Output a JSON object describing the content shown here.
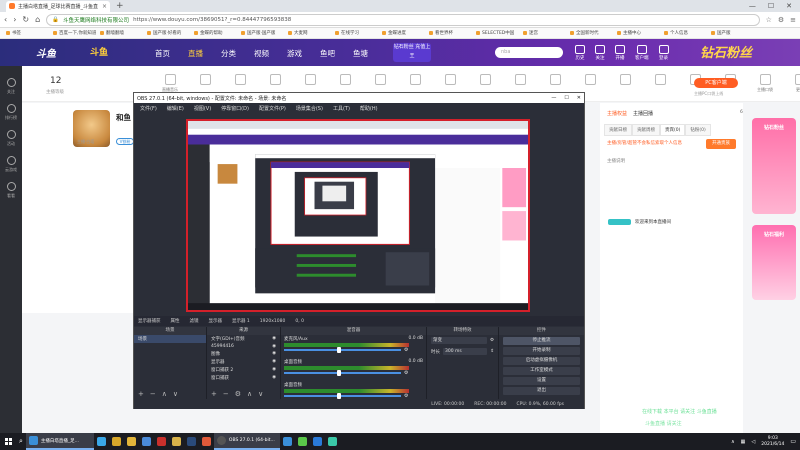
{
  "browser": {
    "tab_title": "主播白塔直播_足球比赛直播_斗鱼直",
    "new_tab": "+",
    "host": "斗鱼天鹰网络科技有限公司",
    "url": "https://www.douyu.com/3869051?_r=0.84447796593838",
    "bookmarks": [
      "书签",
      "百度一下,你就知道",
      "翻墙翻墙",
      "国产版·好看的",
      "金蝶的帮助",
      "国产版·国产版",
      "大麦网",
      "在线学习",
      "金蝶进度",
      "看世界杯",
      "SELECTED中国",
      "迷宫",
      "全国新时代",
      "主播中心",
      "个人信息",
      "国产版"
    ]
  },
  "site": {
    "logo": "斗鱼",
    "logo_sub": "斗鱼",
    "nav": [
      "首页",
      "直播",
      "分类",
      "视频",
      "游戏",
      "鱼吧",
      "鱼塘"
    ],
    "nav_active": 1,
    "promo": "钻石粉丝 充值上王",
    "search_placeholder": "nba",
    "header_icons": [
      "历史",
      "关注",
      "开播",
      "客户端",
      "登录"
    ],
    "banner_text": "钻石粉丝"
  },
  "leftbar": {
    "items": [
      "关注",
      "排行榜",
      "活动",
      "云游戏",
      "看看"
    ]
  },
  "room": {
    "fans": "12",
    "fans_label": "主播等级",
    "tools": [
      "直播音乐",
      "",
      "",
      "",
      "",
      "",
      "",
      "",
      "",
      "",
      "",
      "",
      "",
      "",
      "",
      "",
      "",
      "主播口袋",
      "更多"
    ],
    "pc_btn": "PC客户端",
    "pc_sub": "主播PC口袋上线",
    "streamer_name": "和鱼",
    "streamer_tag": "V铁粉",
    "streamer_tag2": "主播·白塔"
  },
  "chat": {
    "top_tabs": [
      "主播权益",
      "主播回播"
    ],
    "badge": "6",
    "tabs": [
      "贡献日榜",
      "贡献周榜",
      "贵宾(0)",
      "钻粉(0)"
    ],
    "notice": "主播/房管/超管不会私信索取个人信息",
    "action_btn": "开通贵族",
    "msg1": "主播说明",
    "msg2": "欢迎来到本直播间"
  },
  "ads": [
    "钻石粉丝",
    "钻石福利"
  ],
  "obs": {
    "title": "OBS 27.0.1 (64-bit, windows) - 配置文件: 未命名 - 场景: 未命名",
    "menu": [
      "文件(F)",
      "编辑(E)",
      "视图(V)",
      "停靠窗口(D)",
      "配置文件(P)",
      "场景集合(S)",
      "工具(T)",
      "帮助(H)"
    ],
    "status_strip": [
      "显示器捕获",
      "属性",
      "滤镜",
      "显示器",
      "显示器 1",
      "1920x1080",
      "0, 0"
    ],
    "docks": {
      "scenes": {
        "title": "场景",
        "items": [
          "场景"
        ]
      },
      "sources": {
        "title": "来源",
        "items": [
          "文字(GDI+)音频",
          "45994416",
          "图像",
          "显示器",
          "窗口捕获 2",
          "窗口捕获"
        ]
      },
      "mixer": {
        "title": "混音器",
        "tracks": [
          {
            "name": "麦克风/Aux",
            "db": "0.0 dB"
          },
          {
            "name": "桌面音频",
            "db": "0.0 dB"
          },
          {
            "name": "桌面音频",
            "db": ""
          }
        ]
      },
      "transitions": {
        "title": "转场特效",
        "type_label": "渐变",
        "duration_label": "时长",
        "duration": "300 ms"
      },
      "controls": {
        "title": "控件",
        "buttons": [
          "停止推流",
          "开始录制",
          "启动虚拟摄像机",
          "工作室模式",
          "设置",
          "退出"
        ]
      }
    },
    "status": {
      "live": "LIVE: 00:00:00",
      "rec": "REC: 00:00:00",
      "cpu": "CPU: 0.9%, 60.00 fps"
    }
  },
  "watermark": [
    "在线下载 本平台 请关注 斗鱼直播",
    "斗鱼直播 请关注"
  ],
  "taskbar": {
    "active_app": "主播白塔直播_足...",
    "obs_app": "OBS 27.0.1 (64-bit...",
    "time": "9:03",
    "date": "2021/6/14"
  }
}
